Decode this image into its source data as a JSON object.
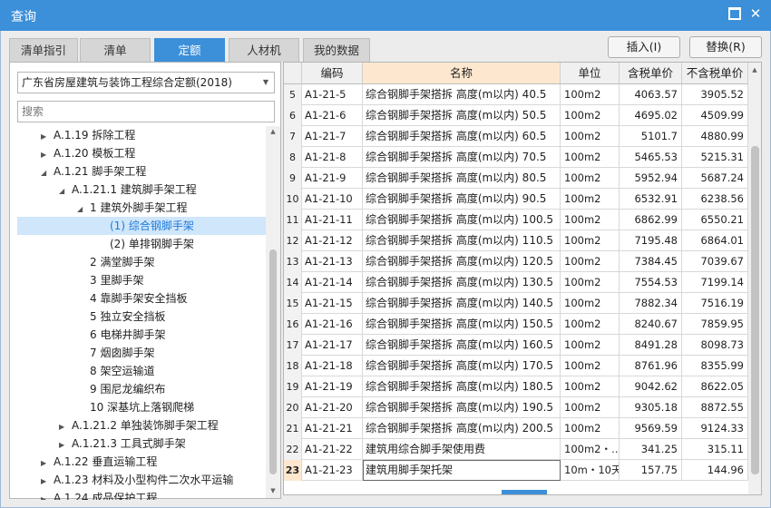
{
  "window": {
    "title": "查询"
  },
  "tabs": [
    {
      "label": "清单指引",
      "active": false
    },
    {
      "label": "清单",
      "active": false
    },
    {
      "label": "定额",
      "active": true
    },
    {
      "label": "人材机",
      "active": false
    },
    {
      "label": "我的数据",
      "active": false
    }
  ],
  "buttons": {
    "insert": "插入(I)",
    "replace": "替换(R)"
  },
  "left": {
    "library": "广东省房屋建筑与装饰工程综合定额(2018)",
    "search_placeholder": "搜索",
    "tree": [
      {
        "label": "A.1.19 拆除工程",
        "level": 1,
        "arrow": "right"
      },
      {
        "label": "A.1.20 模板工程",
        "level": 1,
        "arrow": "right"
      },
      {
        "label": "A.1.21 脚手架工程",
        "level": 1,
        "arrow": "down"
      },
      {
        "label": "A.1.21.1 建筑脚手架工程",
        "level": 2,
        "arrow": "down"
      },
      {
        "label": "1 建筑外脚手架工程",
        "level": 3,
        "arrow": "down"
      },
      {
        "label": "(1) 综合钢脚手架",
        "level": 4,
        "arrow": "",
        "selected": true
      },
      {
        "label": "(2) 单排钢脚手架",
        "level": 4,
        "arrow": ""
      },
      {
        "label": "2 满堂脚手架",
        "level": 3,
        "arrow": ""
      },
      {
        "label": "3 里脚手架",
        "level": 3,
        "arrow": ""
      },
      {
        "label": "4 靠脚手架安全挡板",
        "level": 3,
        "arrow": ""
      },
      {
        "label": "5 独立安全挡板",
        "level": 3,
        "arrow": ""
      },
      {
        "label": "6 电梯井脚手架",
        "level": 3,
        "arrow": ""
      },
      {
        "label": "7 烟囱脚手架",
        "level": 3,
        "arrow": ""
      },
      {
        "label": "8 架空运输道",
        "level": 3,
        "arrow": ""
      },
      {
        "label": "9 围尼龙编织布",
        "level": 3,
        "arrow": ""
      },
      {
        "label": "10 深基坑上落钢爬梯",
        "level": 3,
        "arrow": ""
      },
      {
        "label": "A.1.21.2 单独装饰脚手架工程",
        "level": 2,
        "arrow": "right"
      },
      {
        "label": "A.1.21.3 工具式脚手架",
        "level": 2,
        "arrow": "right"
      },
      {
        "label": "A.1.22 垂直运输工程",
        "level": 1,
        "arrow": "right"
      },
      {
        "label": "A.1.23 材料及小型构件二次水平运输",
        "level": 1,
        "arrow": "right"
      },
      {
        "label": "A.1.24 成品保护工程",
        "level": 1,
        "arrow": "right"
      }
    ]
  },
  "table": {
    "columns": [
      "",
      "编码",
      "名称",
      "单位",
      "含税单价",
      "不含税单价"
    ],
    "rows": [
      [
        "5",
        "A1-21-5",
        "综合钢脚手架搭拆 高度(m以内) 40.5",
        "100m2",
        "4063.57",
        "3905.52"
      ],
      [
        "6",
        "A1-21-6",
        "综合钢脚手架搭拆 高度(m以内) 50.5",
        "100m2",
        "4695.02",
        "4509.99"
      ],
      [
        "7",
        "A1-21-7",
        "综合钢脚手架搭拆 高度(m以内) 60.5",
        "100m2",
        "5101.7",
        "4880.99"
      ],
      [
        "8",
        "A1-21-8",
        "综合钢脚手架搭拆 高度(m以内) 70.5",
        "100m2",
        "5465.53",
        "5215.31"
      ],
      [
        "9",
        "A1-21-9",
        "综合钢脚手架搭拆 高度(m以内) 80.5",
        "100m2",
        "5952.94",
        "5687.24"
      ],
      [
        "10",
        "A1-21-10",
        "综合钢脚手架搭拆 高度(m以内) 90.5",
        "100m2",
        "6532.91",
        "6238.56"
      ],
      [
        "11",
        "A1-21-11",
        "综合钢脚手架搭拆 高度(m以内) 100.5",
        "100m2",
        "6862.99",
        "6550.21"
      ],
      [
        "12",
        "A1-21-12",
        "综合钢脚手架搭拆 高度(m以内) 110.5",
        "100m2",
        "7195.48",
        "6864.01"
      ],
      [
        "13",
        "A1-21-13",
        "综合钢脚手架搭拆 高度(m以内) 120.5",
        "100m2",
        "7384.45",
        "7039.67"
      ],
      [
        "14",
        "A1-21-14",
        "综合钢脚手架搭拆 高度(m以内) 130.5",
        "100m2",
        "7554.53",
        "7199.14"
      ],
      [
        "15",
        "A1-21-15",
        "综合钢脚手架搭拆 高度(m以内) 140.5",
        "100m2",
        "7882.34",
        "7516.19"
      ],
      [
        "16",
        "A1-21-16",
        "综合钢脚手架搭拆 高度(m以内) 150.5",
        "100m2",
        "8240.67",
        "7859.95"
      ],
      [
        "17",
        "A1-21-17",
        "综合钢脚手架搭拆 高度(m以内) 160.5",
        "100m2",
        "8491.28",
        "8098.73"
      ],
      [
        "18",
        "A1-21-18",
        "综合钢脚手架搭拆 高度(m以内) 170.5",
        "100m2",
        "8761.96",
        "8355.99"
      ],
      [
        "19",
        "A1-21-19",
        "综合钢脚手架搭拆 高度(m以内) 180.5",
        "100m2",
        "9042.62",
        "8622.05"
      ],
      [
        "20",
        "A1-21-20",
        "综合钢脚手架搭拆 高度(m以内) 190.5",
        "100m2",
        "9305.18",
        "8872.55"
      ],
      [
        "21",
        "A1-21-21",
        "综合钢脚手架搭拆 高度(m以内) 200.5",
        "100m2",
        "9569.59",
        "9124.33"
      ],
      [
        "22",
        "A1-21-22",
        "建筑用综合脚手架使用费",
        "100m2・…",
        "341.25",
        "315.11"
      ],
      [
        "23",
        "A1-21-23",
        "建筑用脚手架托架",
        "10m・10天",
        "157.75",
        "144.96"
      ]
    ],
    "selected_row": 18
  }
}
